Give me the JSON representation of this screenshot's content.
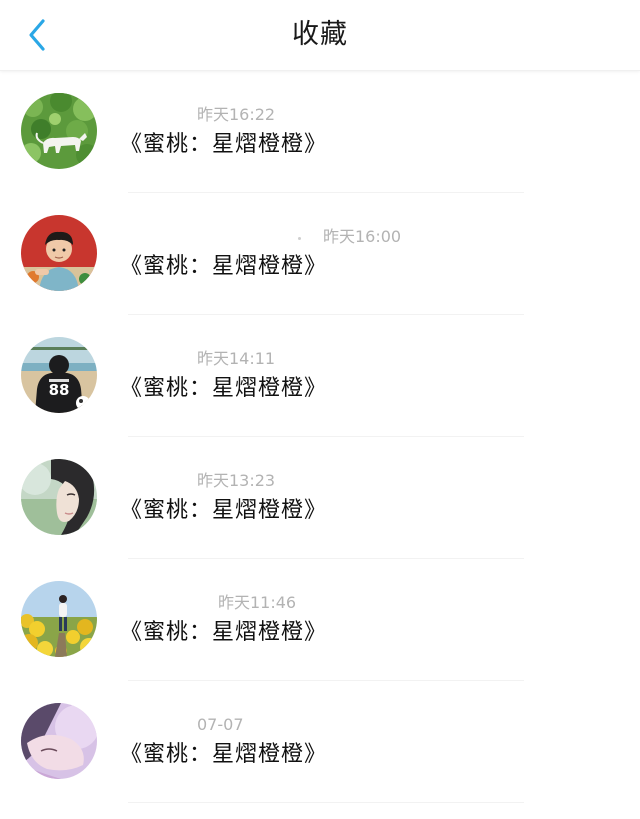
{
  "header": {
    "title": "收藏",
    "back_icon": "chevron-left-icon",
    "accent_color": "#2aa7e6"
  },
  "items": [
    {
      "time": "昨天16:22",
      "text": "《蜜桃：星熠橙橙》",
      "avatar": "avatar-green-cat"
    },
    {
      "time": "昨天16:00",
      "text": "《蜜桃：星熠橙橙》",
      "avatar": "avatar-boy-red"
    },
    {
      "time": "昨天14:11",
      "text": "《蜜桃：星熠橙橙》",
      "avatar": "avatar-beach-88"
    },
    {
      "time": "昨天13:23",
      "text": "《蜜桃：星熠橙橙》",
      "avatar": "avatar-girl-soft"
    },
    {
      "time": "昨天11:46",
      "text": "《蜜桃：星熠橙橙》",
      "avatar": "avatar-flowers"
    },
    {
      "time": "07-07",
      "text": "《蜜桃：星熠橙橙》",
      "avatar": "avatar-pink"
    }
  ]
}
